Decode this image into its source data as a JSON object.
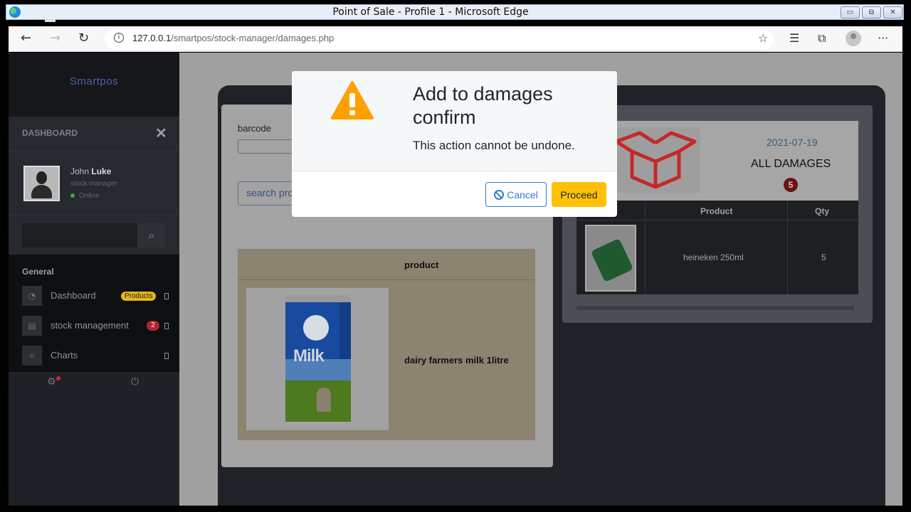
{
  "window": {
    "title": "Point of Sale - Profile 1 - Microsoft Edge"
  },
  "browser": {
    "url_host": "127.0.0.1",
    "url_path": "/smartpos/stock-manager/damages.php"
  },
  "sidebar": {
    "brand": "Smartpos",
    "dashboard_title": "DASHBOARD",
    "user": {
      "first_name": "John",
      "last_name": "Luke",
      "role": "stock manager",
      "status": "Online"
    },
    "search_placeholder": "",
    "menu_header": "General",
    "items": [
      {
        "label": "Dashboard",
        "badge": "Products"
      },
      {
        "label": "stock management",
        "badge": "2"
      },
      {
        "label": "Charts",
        "badge": ""
      }
    ]
  },
  "form": {
    "barcode_label": "barcode",
    "barcode_value": "",
    "search_button": "search products"
  },
  "product_table": {
    "header": "product",
    "rows": [
      {
        "name": "dairy farmers milk 1litre"
      }
    ]
  },
  "damages": {
    "date": "2021-07-19",
    "title": "ALL DAMAGES",
    "count": "5",
    "columns": [
      "Product",
      "Qty"
    ],
    "rows": [
      {
        "product": "heineken 250ml",
        "qty": "5"
      }
    ]
  },
  "modal": {
    "title": "Add to damages confirm",
    "text": "This action cannot be undone.",
    "cancel_label": "Cancel",
    "proceed_label": "Proceed"
  },
  "colors": {
    "warning": "#ffa000",
    "proceed": "#ffc107",
    "cancel_border": "#2e7bd6",
    "damage_box": "#c62828"
  }
}
